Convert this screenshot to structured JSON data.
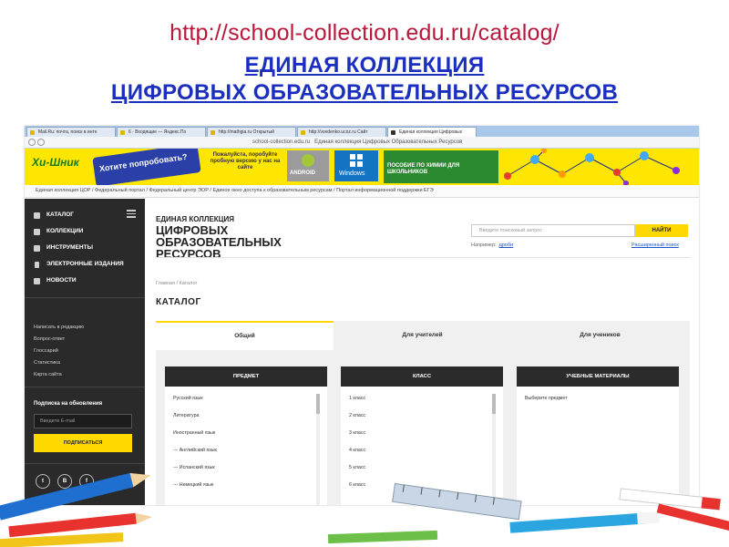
{
  "slide": {
    "url": "http://school-collection.edu.ru/catalog/",
    "title_line1": "ЕДИНАЯ КОЛЛЕКЦИЯ",
    "title_line2": "ЦИФРОВЫХ ОБРАЗОВАТЕЛЬНЫХ РЕСУРСОВ"
  },
  "browser": {
    "tabs": [
      "Mail.Ru: почта, поиск в инте",
      "6 · Входящие — Яндекс.По",
      "http://mathgia.ru Открытый",
      "http://vovdenko.ucoz.ru Сайт",
      "Единая коллекция Цифровых"
    ],
    "address": "school-collection.edu.ru",
    "page_title": "Единая коллекция Цифровых Образовательных Ресурсов"
  },
  "banner": {
    "logo": "Хи-Шник",
    "ask": "Хотите попробовать?",
    "mid": "Пожалуйста, поробуйте пробную версию у нас на сайте",
    "android": "ANDROID",
    "windows": "Windows",
    "chem": "ПОСОБИЕ ПО ХИМИИ ДЛЯ ШКОЛЬНИКОВ",
    "colors": {
      "yellow": "#ffe600",
      "blue": "#1573c4",
      "green": "#2b8a30"
    }
  },
  "breadcrumbs": "Единая коллекция ЦОР  /  Федеральный портал  /  Федеральный центр ЭОР  /  Единое окно доступа к образовательным ресурсам  /  Портал информационной поддержки ЕГЭ",
  "sidebar": {
    "nav": [
      {
        "label": "КАТАЛОГ",
        "icon": "grid-icon"
      },
      {
        "label": "КОЛЛЕКЦИИ",
        "icon": "books-icon"
      },
      {
        "label": "ИНСТРУМЕНТЫ",
        "icon": "wrench-icon"
      },
      {
        "label": "ЭЛЕКТРОННЫЕ ИЗДАНИЯ",
        "icon": "phone-icon"
      },
      {
        "label": "НОВОСТИ",
        "icon": "newspaper-icon"
      }
    ],
    "links": [
      "Написать в редакцию",
      "Вопрос-ответ",
      "Глоссарий",
      "Статистика",
      "Карта сайта"
    ],
    "subscribe_title": "Подписка на обновления",
    "email_placeholder": "Введите E-mail",
    "subscribe_button": "ПОДПИСАТЬСЯ",
    "social": [
      "Twitter",
      "ВКонтакте",
      "Facebook"
    ],
    "social_glyphs": [
      "t",
      "B",
      "f"
    ]
  },
  "brand": {
    "line1": "ЕДИНАЯ КОЛЛЕКЦИЯ",
    "line2": "ЦИФРОВЫХ",
    "line3": "ОБРАЗОВАТЕЛЬНЫХ",
    "line4": "РЕСУРСОВ"
  },
  "search": {
    "placeholder": "Введите поисковый запрос",
    "button": "НАЙТИ",
    "hint_label": "Например:",
    "hint_example": "дроби",
    "advanced": "Расширенный поиск"
  },
  "content": {
    "breadcrumb": "Главная / Каталог",
    "title": "КАТАЛОГ",
    "tabs": [
      "Общий",
      "Для учителей",
      "Для учеников"
    ],
    "columns": [
      {
        "header": "ПРЕДМЕТ",
        "items": [
          "Русский язык",
          "Литература",
          "Иностранный язык",
          "--- Английский язык",
          "--- Испанский язык",
          "--- Немецкий язык"
        ]
      },
      {
        "header": "КЛАСС",
        "items": [
          "1 класс",
          "2 класс",
          "3 класс",
          "4 класс",
          "5 класс",
          "6 класс"
        ]
      },
      {
        "header": "УЧЕБНЫЕ МАТЕРИАЛЫ",
        "items": [
          "Выберите предмет"
        ]
      }
    ]
  }
}
